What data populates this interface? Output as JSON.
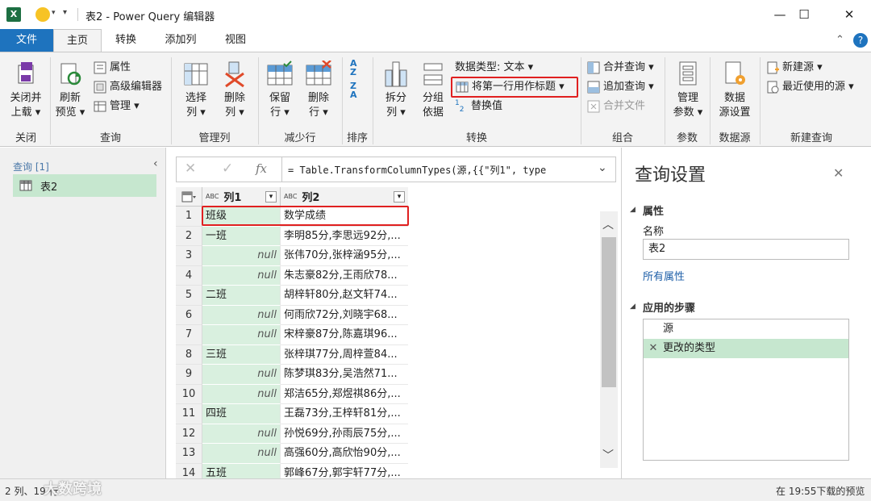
{
  "titlebar": {
    "title": "表2 - Power Query 编辑器",
    "minimize_glyph": "—",
    "maximize_glyph": "☐",
    "close_glyph": "✕"
  },
  "tabs": [
    {
      "label": "文件"
    },
    {
      "label": "主页"
    },
    {
      "label": "转换"
    },
    {
      "label": "添加列"
    },
    {
      "label": "视图"
    }
  ],
  "ribbon": {
    "close_load_1": "关闭并",
    "close_load_2": "上载 ▾",
    "refresh_1": "刷新",
    "refresh_2": "预览 ▾",
    "properties": "属性",
    "advanced_editor": "高级编辑器",
    "manage": "管理 ▾",
    "choose_cols_1": "选择",
    "choose_cols_2": "列 ▾",
    "remove_cols_1": "删除",
    "remove_cols_2": "列 ▾",
    "keep_rows_1": "保留",
    "keep_rows_2": "行 ▾",
    "remove_rows_1": "删除",
    "remove_rows_2": "行 ▾",
    "split_1": "拆分",
    "split_2": "列 ▾",
    "group_1": "分组",
    "group_2": "依据",
    "datatype": "数据类型: 文本 ▾",
    "first_row_header": "将第一行用作标题 ▾",
    "replace_values": "替换值",
    "merge_queries": "合并查询 ▾",
    "append_queries": "追加查询 ▾",
    "combine_files": "合并文件",
    "manage_params_1": "管理",
    "manage_params_2": "参数 ▾",
    "datasource_1": "数据",
    "datasource_2": "源设置",
    "new_source": "新建源 ▾",
    "recent_sources": "最近使用的源 ▾",
    "groups": {
      "close": "关闭",
      "query": "查询",
      "manage_cols": "管理列",
      "reduce_rows": "减少行",
      "sort": "排序",
      "transform": "转换",
      "combine": "组合",
      "params": "参数",
      "datasource": "数据源",
      "new_query": "新建查询"
    },
    "colors": {
      "accent_blue": "#1e73be",
      "highlight_red": "#e02020",
      "selection_green": "#c6e7cf"
    }
  },
  "leftpane": {
    "header": "查询 [1]",
    "query_name": "表2"
  },
  "formula": {
    "text": "= Table.TransformColumnTypes(源,{{\"列1\", type",
    "fx": "fx",
    "cancel_glyph": "✕",
    "confirm_glyph": "✓"
  },
  "grid": {
    "col1_header": "列1",
    "col2_header": "列2",
    "type_badge": "ABC",
    "rows": [
      {
        "n": "1",
        "c1": "班级",
        "c2": "数学成绩"
      },
      {
        "n": "2",
        "c1": "一班",
        "c2": "李明85分,李思远92分,..."
      },
      {
        "n": "3",
        "c1": "null",
        "c2": "张伟70分,张梓涵95分,..."
      },
      {
        "n": "4",
        "c1": "null",
        "c2": "朱志豪82分,王雨欣78..."
      },
      {
        "n": "5",
        "c1": "二班",
        "c2": "胡梓轩80分,赵文轩74..."
      },
      {
        "n": "6",
        "c1": "null",
        "c2": "何雨欣72分,刘晓宇68..."
      },
      {
        "n": "7",
        "c1": "null",
        "c2": "宋梓豪87分,陈嘉琪96..."
      },
      {
        "n": "8",
        "c1": "三班",
        "c2": "张梓琪77分,周梓萱84..."
      },
      {
        "n": "9",
        "c1": "null",
        "c2": "陈梦琪83分,吴浩然71..."
      },
      {
        "n": "10",
        "c1": "null",
        "c2": "郑洁65分,郑煜祺86分,..."
      },
      {
        "n": "11",
        "c1": "四班",
        "c2": "王磊73分,王梓轩81分,..."
      },
      {
        "n": "12",
        "c1": "null",
        "c2": "孙悦69分,孙雨辰75分,..."
      },
      {
        "n": "13",
        "c1": "null",
        "c2": "高强60分,高欣怡90分,..."
      },
      {
        "n": "14",
        "c1": "五班",
        "c2": "郭峰67分,郭宇轩77分,..."
      }
    ]
  },
  "settings": {
    "title": "查询设置",
    "properties_header": "属性",
    "name_label": "名称",
    "name_value": "表2",
    "all_properties": "所有属性",
    "steps_header": "应用的步骤",
    "steps": [
      {
        "label": "源"
      },
      {
        "label": "更改的类型"
      }
    ]
  },
  "status": {
    "left": "2 列、19 行",
    "right": "在 19:55下载的预览"
  },
  "watermark": "大数跨境"
}
